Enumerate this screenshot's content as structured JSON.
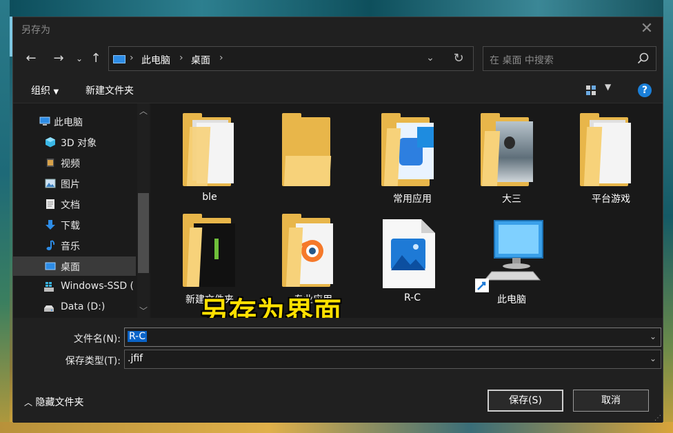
{
  "dialog": {
    "title": "另存为"
  },
  "nav": {
    "breadcrumbs": [
      "此电脑",
      "桌面"
    ],
    "search_placeholder": "在 桌面 中搜索"
  },
  "toolbar": {
    "organize": "组织",
    "new_folder": "新建文件夹"
  },
  "sidebar": {
    "items": [
      {
        "label": "此电脑",
        "icon": "pc-icon"
      },
      {
        "label": "3D 对象",
        "icon": "cube-icon"
      },
      {
        "label": "视频",
        "icon": "video-icon"
      },
      {
        "label": "图片",
        "icon": "picture-icon"
      },
      {
        "label": "文档",
        "icon": "document-icon"
      },
      {
        "label": "下载",
        "icon": "download-arrow-icon"
      },
      {
        "label": "音乐",
        "icon": "music-note-icon"
      },
      {
        "label": "桌面",
        "icon": "desktop-icon",
        "selected": true
      },
      {
        "label": "Windows-SSD (",
        "icon": "drive-icon"
      },
      {
        "label": "Data (D:)",
        "icon": "drive-icon"
      }
    ]
  },
  "files": [
    {
      "name": "ble",
      "type": "folder-docs"
    },
    {
      "name": "",
      "type": "folder-empty"
    },
    {
      "name": "常用应用",
      "type": "folder-app"
    },
    {
      "name": "大三",
      "type": "folder-photo"
    },
    {
      "name": "平台游戏",
      "type": "folder-docs"
    },
    {
      "name": "新建文件夹",
      "type": "folder-dark"
    },
    {
      "name": "专业应用",
      "type": "folder-blender"
    },
    {
      "name": "R-C",
      "type": "image-file"
    },
    {
      "name": "此电脑",
      "type": "pc-shortcut"
    }
  ],
  "overlay": {
    "text": "另存为界面"
  },
  "form": {
    "filename_label": "文件名(N):",
    "filename_value": "R-C",
    "filetype_label": "保存类型(T):",
    "filetype_value": ".jfif"
  },
  "footer": {
    "hide_folders": "隐藏文件夹",
    "save": "保存(S)",
    "cancel": "取消"
  },
  "colors": {
    "accent": "#0a64c8",
    "folder": "#f7d27a",
    "overlay_text": "#ffe000"
  }
}
